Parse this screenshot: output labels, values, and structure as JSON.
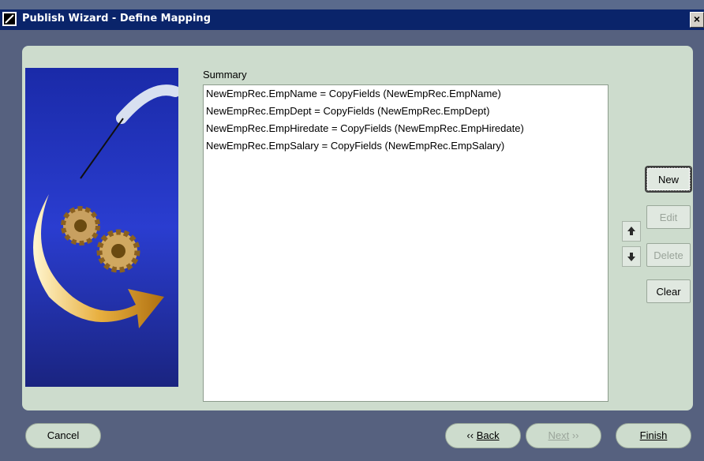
{
  "window": {
    "title": "Publish Wizard - Define Mapping",
    "close_label": "×"
  },
  "summary": {
    "label": "Summary",
    "lines": [
      "NewEmpRec.EmpName = CopyFields (NewEmpRec.EmpName)",
      "NewEmpRec.EmpDept = CopyFields (NewEmpRec.EmpDept)",
      "NewEmpRec.EmpHiredate = CopyFields (NewEmpRec.EmpHiredate)",
      "NewEmpRec.EmpSalary = CopyFields (NewEmpRec.EmpSalary)"
    ]
  },
  "side_buttons": {
    "new": "New",
    "edit": "Edit",
    "delete": "Delete",
    "clear": "Clear"
  },
  "footer": {
    "cancel": "Cancel",
    "back": "Back",
    "next": "Next",
    "finish": "Finish"
  },
  "colors": {
    "panel": "#cddccd",
    "background": "#56617f",
    "titlebar": "#0a246a"
  }
}
